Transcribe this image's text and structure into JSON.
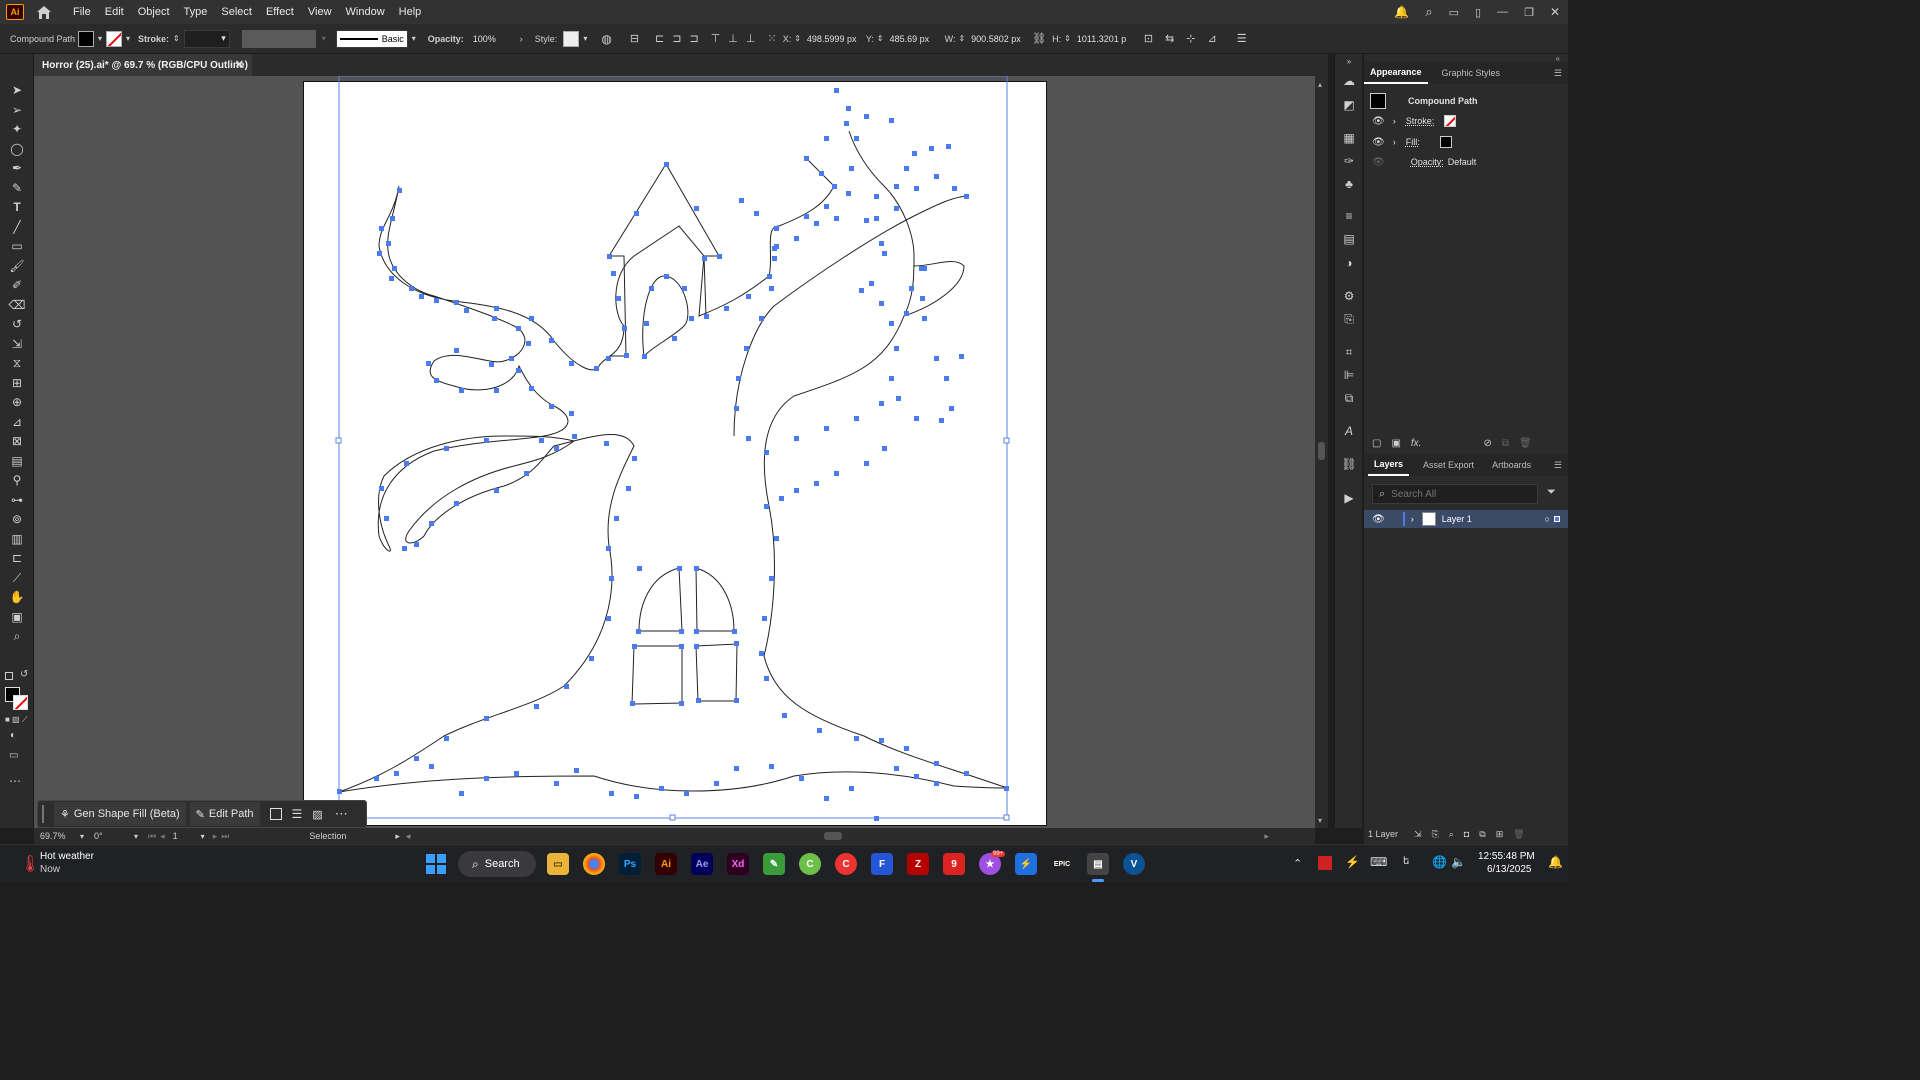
{
  "app": {
    "logo": "Ai"
  },
  "menu": [
    "File",
    "Edit",
    "Object",
    "Type",
    "Select",
    "Effect",
    "View",
    "Window",
    "Help"
  ],
  "control": {
    "selection_type": "Compound Path",
    "stroke_label": "Stroke:",
    "brush_label": "Basic",
    "opacity_label": "Opacity:",
    "opacity_value": "100%",
    "style_label": "Style:",
    "x_label": "X:",
    "x_value": "498.5999 px",
    "y_label": "Y:",
    "y_value": "485.69 px",
    "w_label": "W:",
    "w_value": "900.5802 px",
    "h_label": "H:",
    "h_value": "1011.3201 p"
  },
  "document": {
    "tab_title": "Horror (25).ai* @ 69.7 % (RGB/CPU Outline)"
  },
  "appearance_panel": {
    "tabs": [
      "Appearance",
      "Graphic Styles"
    ],
    "object": "Compound Path",
    "rows": [
      {
        "label": "Stroke:"
      },
      {
        "label": "Fill:"
      },
      {
        "label": "Opacity:",
        "value": "Default"
      }
    ]
  },
  "layers_panel": {
    "tabs": [
      "Layers",
      "Asset Export",
      "Artboards"
    ],
    "search_placeholder": "Search All",
    "layers": [
      {
        "name": "Layer 1"
      }
    ],
    "footer_count": "1 Layer"
  },
  "context_bar": {
    "gen_fill": "Gen Shape Fill (Beta)",
    "edit_path": "Edit Path"
  },
  "status": {
    "zoom": "69.7%",
    "rotation": "0°",
    "artboard": "1",
    "tool": "Selection"
  },
  "taskbar": {
    "weather_title": "Hot weather",
    "weather_sub": "Now",
    "search": "Search",
    "time": "12:55:48 PM",
    "date": "6/13/2025",
    "badge": "99+"
  },
  "colors": {
    "accent": "#4a7cf0",
    "artboard": "#ffffff",
    "pasteboard": "#535353"
  }
}
